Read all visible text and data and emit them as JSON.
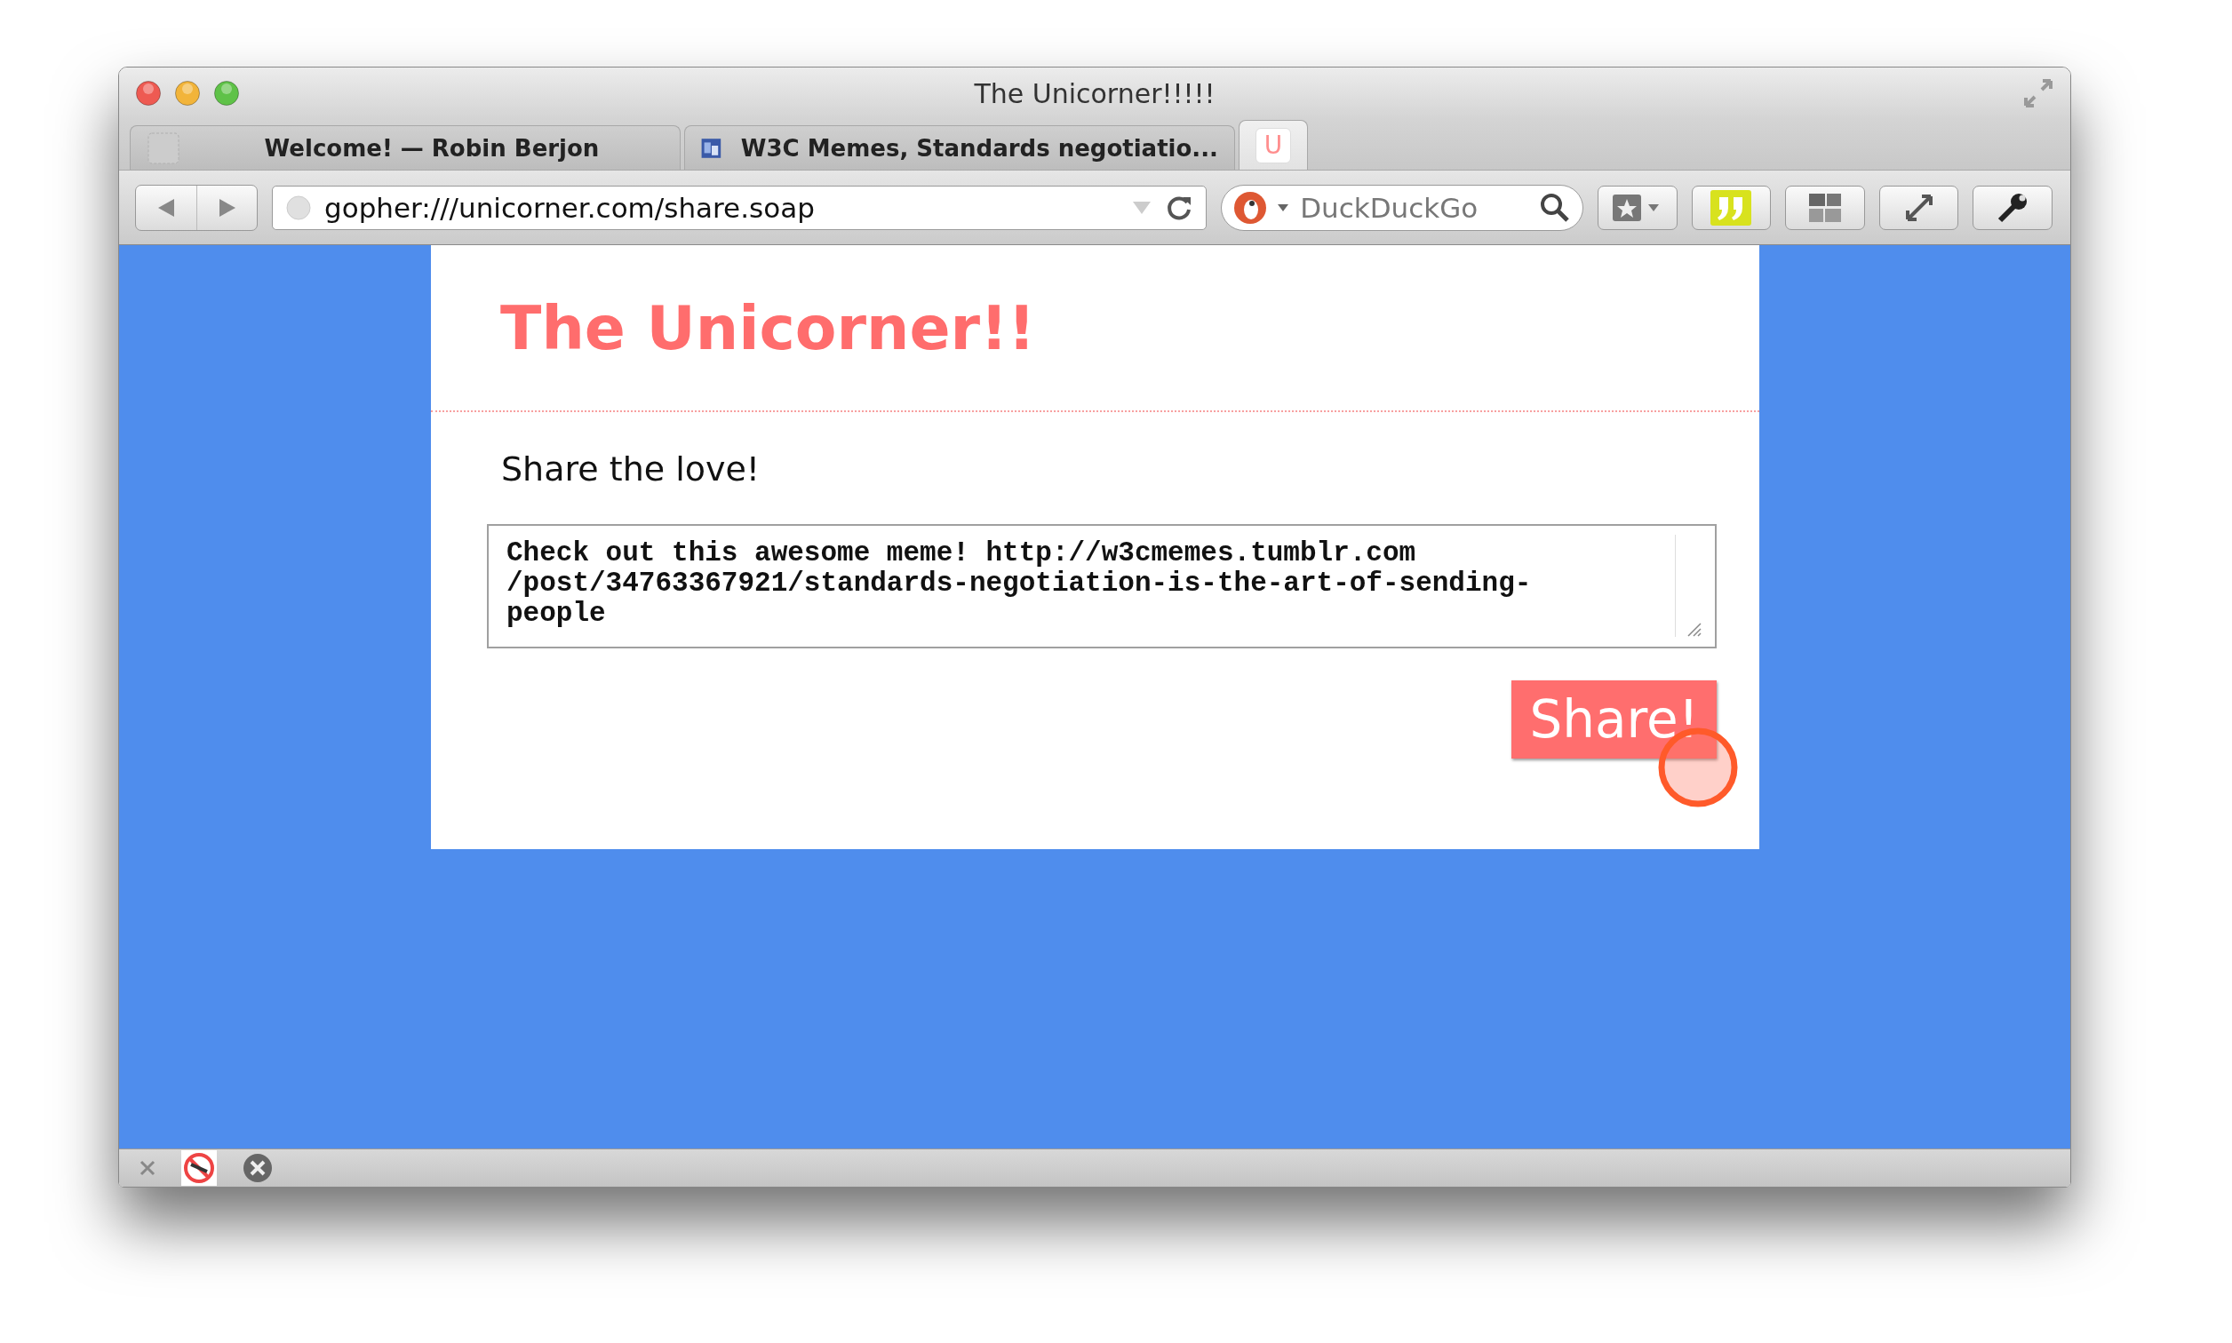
{
  "window": {
    "title": "The Unicorner!!!!!"
  },
  "tabs": [
    {
      "kind": "text",
      "label": "Welcome! — Robin Berjon",
      "selected": false
    },
    {
      "kind": "text",
      "label": "W3C Memes, Standards negotiatio...",
      "selected": false
    },
    {
      "kind": "favicon",
      "label": "U",
      "selected": true
    }
  ],
  "toolbar": {
    "url": "gopher:///unicorner.com/share.soap",
    "search_placeholder": "DuckDuckGo"
  },
  "page": {
    "heading": "The Unicorner!!",
    "prompt": "Share the love!",
    "message_lines": [
      "Check out this awesome meme! http://w3cmemes.tumblr.com",
      "/post/34763367921/standards-negotiation-is-the-art-of-sending-",
      "people"
    ],
    "button": "Share!"
  }
}
